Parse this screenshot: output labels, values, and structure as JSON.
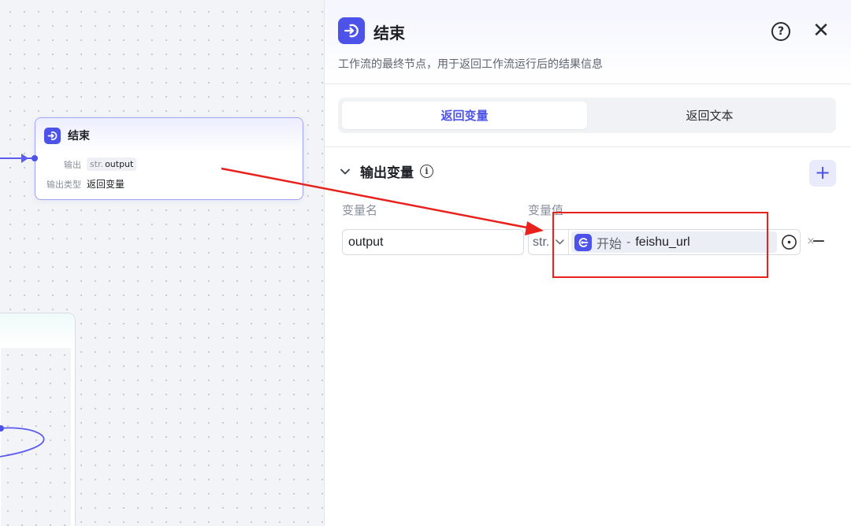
{
  "canvas": {
    "end_node": {
      "icon": "end-node-icon",
      "title": "结束",
      "output_label": "输出",
      "output_tag_type": "str.",
      "output_tag_name": "output",
      "output_type_label": "输出类型",
      "output_type_value": "返回变量"
    }
  },
  "panel": {
    "icon": "end-node-icon",
    "title": "结束",
    "help_icon": "question-circle-icon",
    "close_icon": "close-icon",
    "description": "工作流的最终节点，用于返回工作流运行后的结果信息",
    "tabs": [
      {
        "label": "返回变量",
        "active": true
      },
      {
        "label": "返回文本",
        "active": false
      }
    ],
    "section": {
      "title": "输出变量",
      "info_icon": "info-icon",
      "add_icon": "plus-icon",
      "col_name": "变量名",
      "col_value": "变量值"
    },
    "row": {
      "name_value": "output",
      "type": "str.",
      "ref_node": "开始",
      "ref_separator": "-",
      "ref_variable": "feishu_url",
      "clear_icon": "clear-x-icon",
      "picker_icon": "variable-picker-icon",
      "remove_icon": "minus-icon"
    }
  },
  "colors": {
    "accent": "#4d53e8",
    "annotation": "#e8211c"
  }
}
